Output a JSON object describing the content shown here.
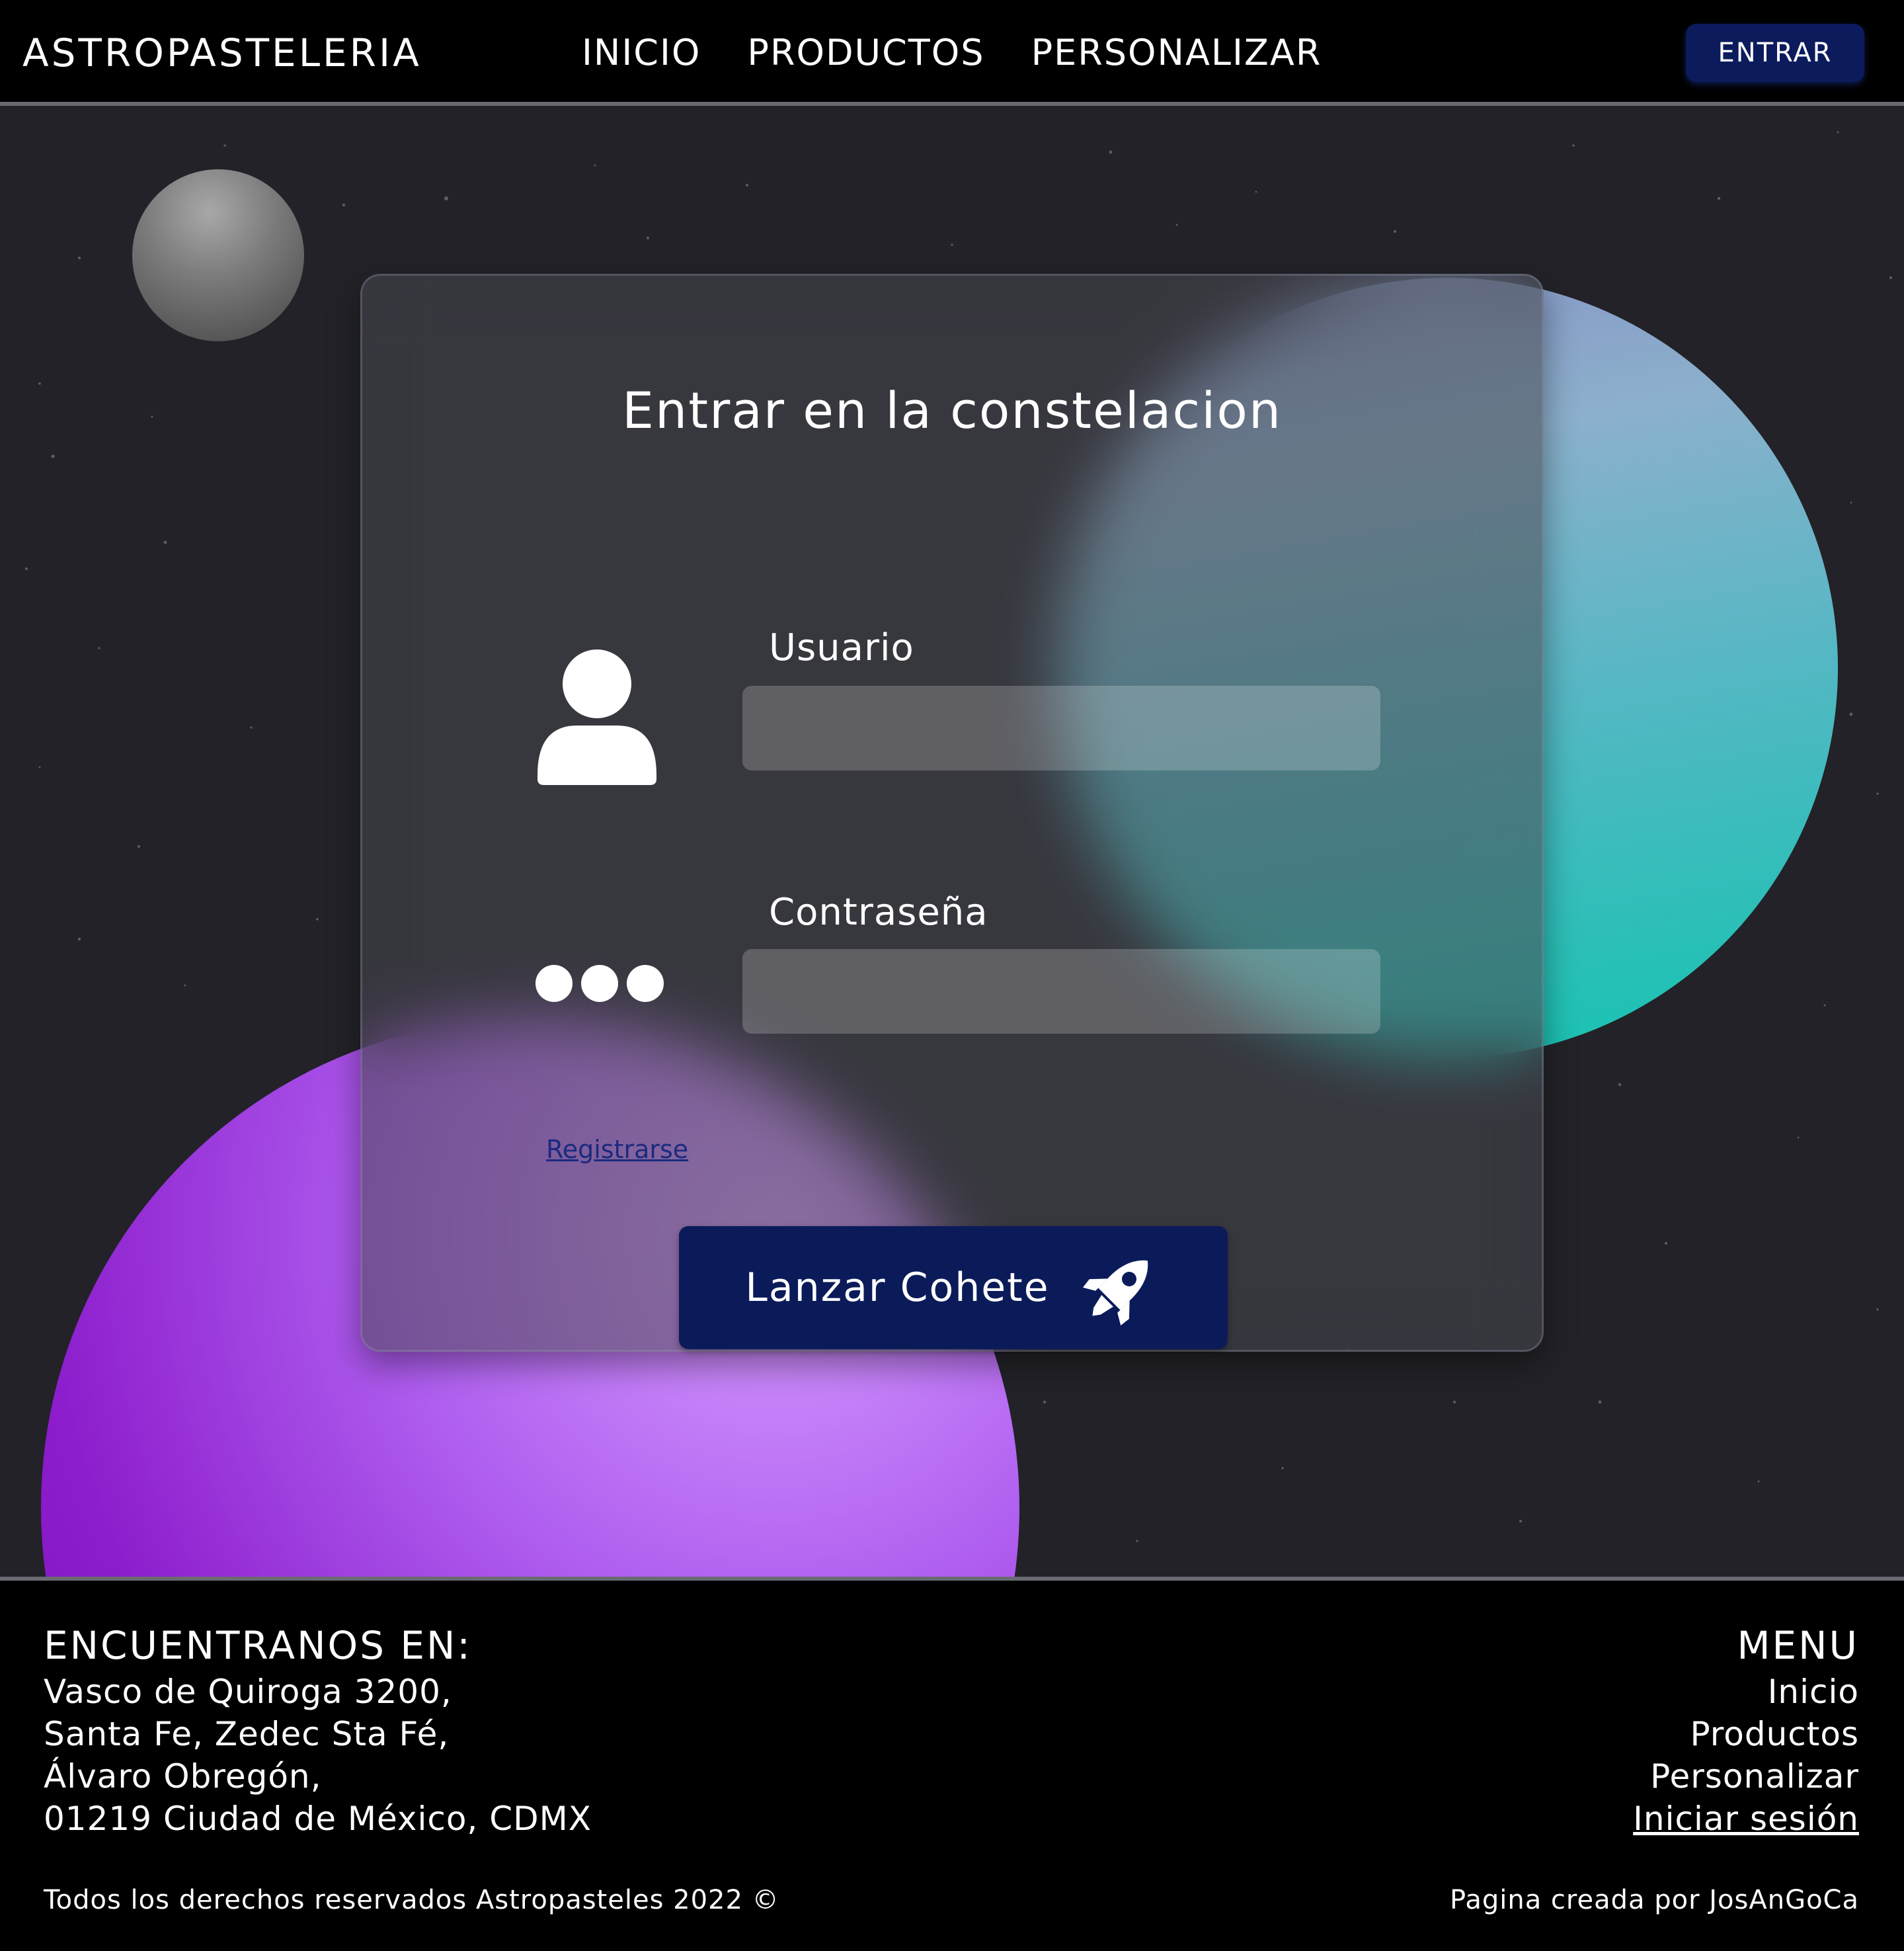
{
  "header": {
    "brand": "ASTROPASTELERIA",
    "nav": [
      "INICIO",
      "PRODUCTOS",
      "PERSONALIZAR"
    ],
    "enter_button": "ENTRAR"
  },
  "login": {
    "title": "Entrar en la constelacion",
    "username_label": "Usuario",
    "username_value": "",
    "password_label": "Contraseña",
    "password_value": "",
    "register_link": "Registrarse",
    "submit_button": "Lanzar Cohete"
  },
  "footer": {
    "address_heading": "ENCUENTRANOS EN:",
    "address_lines": [
      "Vasco de Quiroga 3200,",
      "Santa Fe, Zedec Sta Fé,",
      "Álvaro Obregón,",
      "01219 Ciudad de México, CDMX"
    ],
    "menu_heading": "MENU",
    "menu_links": [
      "Inicio",
      "Productos",
      "Personalizar",
      "Iniciar sesión"
    ],
    "copyright": "Todos los derechos reservados Astropasteles 2022 ©",
    "credit": "Pagina creada por JosAnGoCa"
  },
  "colors": {
    "header_bg": "#000000",
    "space_bg": "#222228",
    "button_navy": "#0b1b5a",
    "teal_planet": "#12c4b0",
    "purple_planet": "#8c1ccc"
  },
  "icons": [
    "user-icon",
    "password-dots-icon",
    "rocket-icon"
  ]
}
